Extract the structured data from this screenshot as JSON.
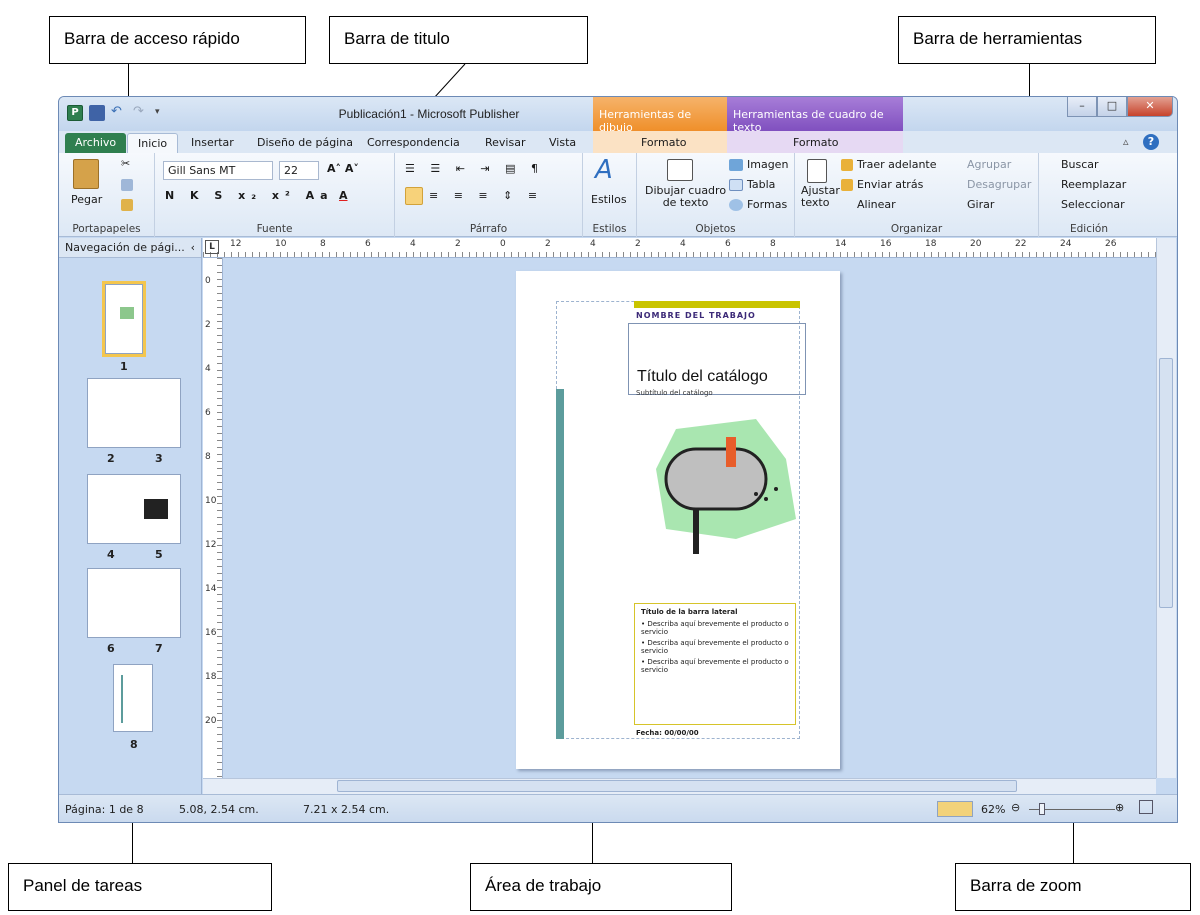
{
  "callouts": {
    "quick_access": "Barra de acceso rápido",
    "title_bar": "Barra de titulo",
    "toolbar": "Barra de herramientas",
    "task_pane": "Panel de tareas",
    "work_area": "Área de trabajo",
    "zoom_bar": "Barra de zoom"
  },
  "window": {
    "title": "Publicación1  -  Microsoft Publisher",
    "context_drawing": "Herramientas de dibujo",
    "context_textbox": "Herramientas de cuadro de texto",
    "colors": {
      "drawing_tools": "#f29c3a",
      "textbox_tools": "#8b58c6",
      "file_tab": "#2f7f4f"
    }
  },
  "tabs": {
    "file": "Archivo",
    "home": "Inicio",
    "insert": "Insertar",
    "page_design": "Diseño de página",
    "mailings": "Correspondencia",
    "review": "Revisar",
    "view": "Vista",
    "format1": "Formato",
    "format2": "Formato"
  },
  "ribbon": {
    "paste": "Pegar",
    "clipboard": "Portapapeles",
    "font_name": "Gill Sans MT",
    "font_size": "22",
    "font": "Fuente",
    "paragraph": "Párrafo",
    "styles_btn": "Estilos",
    "styles": "Estilos",
    "draw_textbox": "Dibujar cuadro\nde texto",
    "image": "Imagen",
    "table": "Tabla",
    "shapes": "Formas",
    "objects": "Objetos",
    "wrap_text": "Ajustar\ntexto",
    "bring_forward": "Traer adelante",
    "send_backward": "Enviar atrás",
    "align": "Alinear",
    "group": "Agrupar",
    "ungroup": "Desagrupar",
    "rotate": "Girar",
    "arrange": "Organizar",
    "find": "Buscar",
    "replace": "Reemplazar",
    "select": "Seleccionar",
    "editing": "Edición"
  },
  "nav": {
    "header": "Navegación de pági...",
    "pages": [
      "1",
      "2",
      "3",
      "4",
      "5",
      "6",
      "7",
      "8"
    ]
  },
  "ruler": {
    "h_labels": [
      "12",
      "10",
      "8",
      "6",
      "4",
      "2",
      "0",
      "2",
      "4",
      "2",
      "4",
      "6",
      "8",
      "14",
      "16",
      "18",
      "20",
      "22",
      "24",
      "26"
    ],
    "v_labels": [
      "0",
      "2",
      "4",
      "6",
      "8",
      "10",
      "12",
      "14",
      "16",
      "18",
      "20"
    ]
  },
  "page": {
    "job_name": "NOMBRE DEL TRABAJO",
    "catalog_title": "Título del catálogo",
    "catalog_subtitle": "Subtítulo del catálogo",
    "sidebar_title": "Título de la barra lateral",
    "bullets": [
      "Describa aquí brevemente el producto o servicio",
      "Describa aquí brevemente el producto o servicio",
      "Describa aquí brevemente el producto o servicio"
    ],
    "date": "Fecha: 00/00/00"
  },
  "status": {
    "page": "Página: 1 de 8",
    "position": "5.08, 2.54 cm.",
    "size": "7.21 x  2.54 cm.",
    "zoom": "62%"
  }
}
